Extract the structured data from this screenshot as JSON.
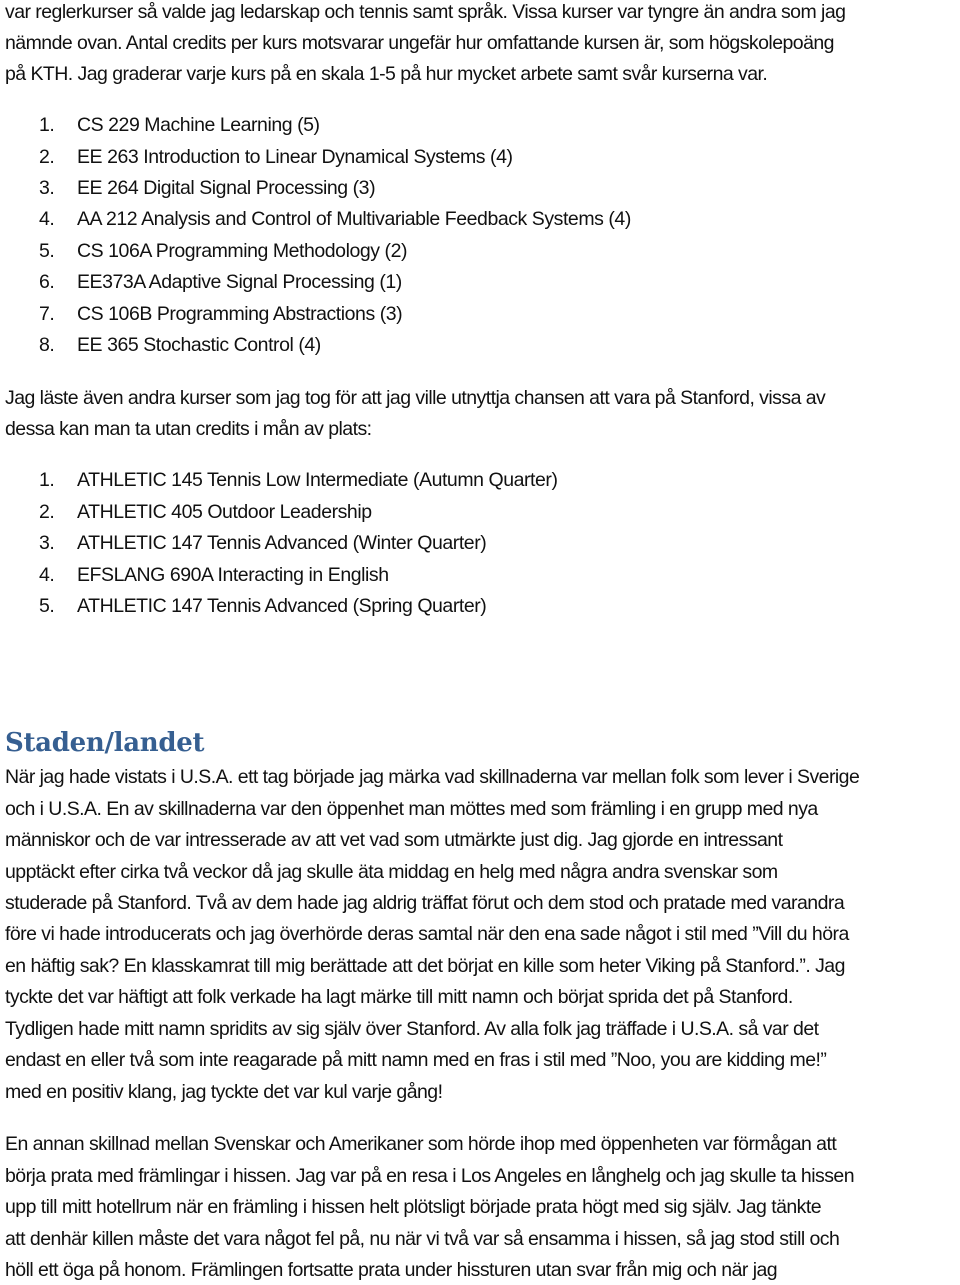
{
  "intro_paragraph": {
    "lines": [
      "var reglerkurser så valde jag ledarskap och tennis samt språk.  Vissa kurser var tyngre än andra som jag",
      "nämnde ovan. Antal credits per kurs motsvarar ungefär hur omfattande kursen är, som högskolepoäng",
      "på KTH. Jag graderar varje kurs på en skala 1-5 på hur mycket arbete samt svår kurserna var."
    ]
  },
  "graded_courses": [
    {
      "number": "1.",
      "text": "CS 229 Machine Learning (5)"
    },
    {
      "number": "2.",
      "text": "EE 263 Introduction to Linear Dynamical Systems (4)"
    },
    {
      "number": "3.",
      "text": "EE 264 Digital Signal Processing (3)"
    },
    {
      "number": "4.",
      "text": "AA 212 Analysis and Control of Multivariable Feedback Systems (4)"
    },
    {
      "number": "5.",
      "text": "CS 106A Programming Methodology (2)"
    },
    {
      "number": "6.",
      "text": "EE373A Adaptive Signal Processing (1)"
    },
    {
      "number": "7.",
      "text": "CS 106B Programming Abstractions (3)"
    },
    {
      "number": "8.",
      "text": "EE 365 Stochastic Control (4)"
    }
  ],
  "extra_paragraph": {
    "lines": [
      "Jag läste även andra kurser som jag tog för att jag ville utnyttja chansen att vara på Stanford, vissa av",
      "dessa kan man ta utan credits i mån av plats:"
    ]
  },
  "extra_courses": [
    {
      "number": "1.",
      "text": "ATHLETIC 145 Tennis Low Intermediate (Autumn Quarter)"
    },
    {
      "number": "2.",
      "text": "ATHLETIC 405 Outdoor Leadership"
    },
    {
      "number": "3.",
      "text": "ATHLETIC 147 Tennis Advanced (Winter Quarter)"
    },
    {
      "number": "4.",
      "text": "EFSLANG 690A Interacting in English"
    },
    {
      "number": "5.",
      "text": "ATHLETIC 147 Tennis Advanced (Spring Quarter)"
    }
  ],
  "section": {
    "heading": "Staden/landet",
    "heading_color": "#365f91",
    "paragraph_1": {
      "lines": [
        "När jag hade vistats i U.S.A. ett tag började jag märka vad skillnaderna var mellan folk som lever i Sverige",
        "och i U.S.A. En av skillnaderna var den öppenhet man möttes med som främling i en grupp med nya",
        "människor och de var intresserade av att vet vad som utmärkte just dig. Jag gjorde en intressant",
        "upptäckt efter cirka två veckor då jag skulle äta middag en helg med några andra svenskar som",
        "studerade på Stanford. Två av dem hade jag aldrig träffat förut och dem stod och pratade med varandra",
        "före vi hade introducerats och jag överhörde deras samtal när den ena sade något i stil med ”Vill du höra",
        "en häftig sak? En klasskamrat till mig berättade att det börjat en kille som heter Viking på Stanford.”.  Jag",
        "tyckte det var häftigt att folk verkade ha lagt märke till mitt namn och börjat sprida det på Stanford.",
        "Tydligen hade mitt namn spridits av sig själv över Stanford. Av alla folk jag träffade i U.S.A. så var det",
        "endast en eller två som inte reagarade på mitt namn med en fras i stil med ”Noo, you are kidding me!”",
        "med en positiv klang, jag tyckte det var kul varje gång!"
      ]
    },
    "paragraph_2": {
      "lines": [
        "En annan skillnad mellan Svenskar och Amerikaner som hörde ihop med öppenheten var förmågan att",
        "börja prata med främlingar i hissen. Jag var på en resa i Los Angeles en långhelg och jag skulle ta hissen",
        "upp till mitt hotellrum när en främling i hissen helt plötsligt började prata högt med sig själv. Jag tänkte",
        "att denhär killen måste det vara något fel på, nu när vi två var så ensamma i hissen, så jag stod still och",
        "höll ett öga på honom. Främlingen fortsatte prata under hissturen utan svar från mig och när jag"
      ]
    }
  }
}
